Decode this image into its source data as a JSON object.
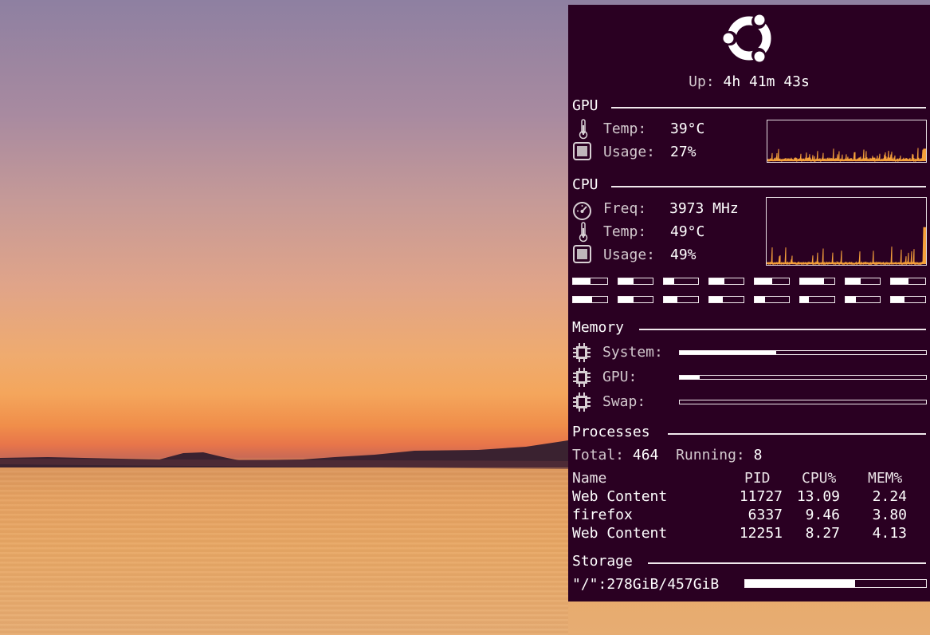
{
  "uptime": {
    "label": "Up:",
    "value": "4h 41m 43s"
  },
  "gpu": {
    "title": "GPU",
    "temp_label": "Temp:",
    "temp_value": "39°C",
    "usage_label": "Usage:",
    "usage_value": "27%"
  },
  "cpu": {
    "title": "CPU",
    "freq_label": "Freq:",
    "freq_value": "3973 MHz",
    "temp_label": "Temp:",
    "temp_value": "49°C",
    "usage_label": "Usage:",
    "usage_value": "49%",
    "core_levels": [
      0.5,
      0.45,
      0.3,
      0.45,
      0.5,
      0.7,
      0.45,
      0.5,
      0.55,
      0.45,
      0.4,
      0.4,
      0.3,
      0.25,
      0.3,
      0.4
    ]
  },
  "memory": {
    "title": "Memory",
    "items": [
      {
        "label": "System:",
        "level": 0.39
      },
      {
        "label": "GPU:",
        "level": 0.08
      },
      {
        "label": "Swap:",
        "level": 0.0
      }
    ]
  },
  "processes": {
    "title": "Processes",
    "total_label": "Total:",
    "total_value": "464",
    "running_label": "Running:",
    "running_value": "8",
    "headers": {
      "name": "Name",
      "pid": "PID",
      "cpu": "CPU%",
      "mem": "MEM%"
    },
    "rows": [
      {
        "name": "Web Content",
        "pid": "11727",
        "cpu": "13.09",
        "mem": "2.24"
      },
      {
        "name": "firefox",
        "pid": "6337",
        "cpu": "9.46",
        "mem": "3.80"
      },
      {
        "name": "Web Content",
        "pid": "12251",
        "cpu": "8.27",
        "mem": "4.13"
      }
    ]
  },
  "storage": {
    "title": "Storage",
    "root": "\"/\":278GiB/457GiB",
    "level": 0.608
  },
  "colors": {
    "panel_bg": "#2a0022",
    "graph_line": "#f5a03a",
    "text": "#ffffff"
  },
  "icons": {
    "logo": "ubuntu-logo",
    "temp": "thermometer-icon",
    "usage": "cpu-square-icon",
    "freq": "speedometer-icon",
    "mem": "chip-icon"
  }
}
